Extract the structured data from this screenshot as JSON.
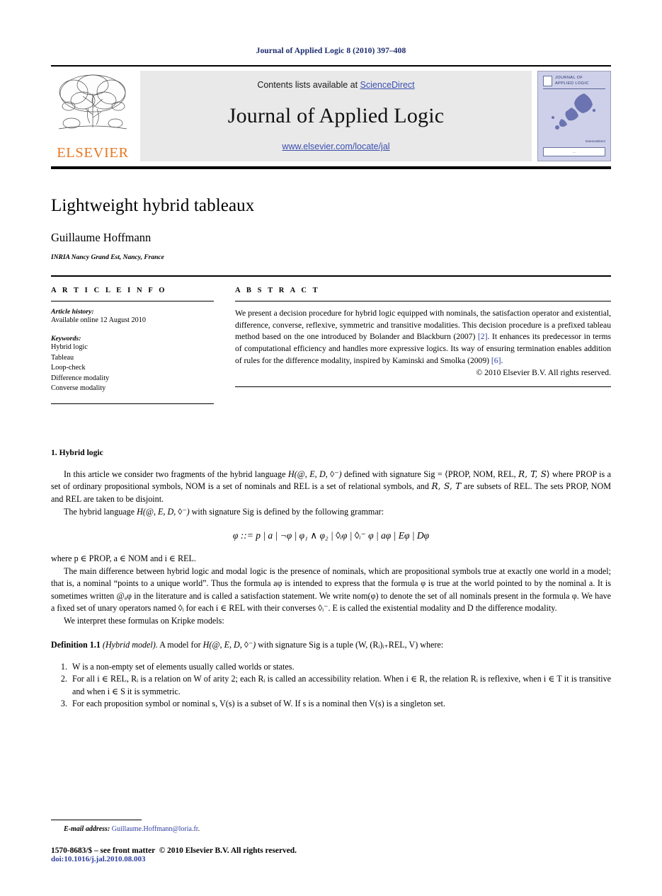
{
  "masthead": {
    "citation": "Journal of Applied Logic 8 (2010) 397–408"
  },
  "banner": {
    "contents_prefix": "Contents lists available at ",
    "sciencedirect": "ScienceDirect",
    "journal_name": "Journal of Applied Logic",
    "journal_url": "www.elsevier.com/locate/jal",
    "publisher": "ELSEVIER",
    "cover": {
      "title": "JOURNAL OF\nAPPLIED LOGIC",
      "line1": "JOURNAL OF",
      "line2": "APPLIED LOGIC",
      "sd_label": "ScienceDirect",
      "box_label": "...."
    },
    "band_color": "#e9e9e9",
    "link_color": "#3b4fb0",
    "elsevier_orange": "#E87722"
  },
  "article": {
    "title": "Lightweight hybrid tableaux",
    "author": "Guillaume Hoffmann",
    "affiliation": "INRIA Nancy Grand Est, Nancy, France"
  },
  "info": {
    "heading": "A R T I C L E   I N F O",
    "history_label": "Article history:",
    "history_value": "Available online 12 August 2010",
    "keywords_label": "Keywords:",
    "keywords": [
      "Hybrid logic",
      "Tableau",
      "Loop-check",
      "Difference modality",
      "Converse modality"
    ]
  },
  "abstract": {
    "heading": "A B S T R A C T",
    "part1": "We present a decision procedure for hybrid logic equipped with nominals, the satisfaction operator and existential, difference, converse, reflexive, symmetric and transitive modalities. This decision procedure is a prefixed tableau method based on the one introduced by Bolander and Blackburn (2007) ",
    "cite1": "[2]",
    "part2": ". It enhances its predecessor in terms of computational efficiency and handles more expressive logics. Its way of ensuring termination enables addition of rules for the difference modality, inspired by Kaminski and Smolka (2009) ",
    "cite2": "[6]",
    "part3": ".",
    "copyright": "© 2010 Elsevier B.V. All rights reserved.",
    "citation_color": "#2f3fa0"
  },
  "section1": {
    "heading": "1.  Hybrid logic",
    "para1_a": "In this article we consider two fragments of the hybrid language ",
    "para1_lang": "H(@, E, D, ◊⁻)",
    "para1_b": " defined with signature Sig = ⟨PROP, NOM, REL, ",
    "para1_cal1": "R, T, S",
    "para1_c": "⟩ where PROP is a set of ordinary propositional symbols, NOM is a set of nominals and REL is a set of relational symbols, and ",
    "para1_cal2": "R, S, T",
    "para1_d": " are subsets of REL. The sets PROP, NOM and REL are taken to be disjoint.",
    "para2_a": "The hybrid language ",
    "para2_lang": "H(@, E, D, ◊⁻)",
    "para2_b": " with signature Sig is defined by the following grammar:",
    "grammar": "φ ::= p | a | ¬φ | φ₁ ∧ φ₂ | ◊ᵢφ | ◊ᵢ⁻ φ | aφ | Eφ | Dφ",
    "where_line": "where p ∈ PROP, a ∈ NOM and i ∈ REL.",
    "para3": "The main difference between hybrid logic and modal logic is the presence of nominals, which are propositional symbols true at exactly one world in a model; that is, a nominal “points to a unique world”. Thus the formula aφ is intended to express that the formula φ is true at the world pointed to by the nominal a. It is sometimes written @ₐφ in the literature and is called a satisfaction statement. We write nom(φ) to denote the set of all nominals present in the formula φ. We have a fixed set of unary operators named ◊ᵢ for each i ∈ REL with their converses ◊ᵢ⁻. E is called the existential modality and D the difference modality.",
    "para4": "We interpret these formulas on Kripke models:"
  },
  "definition": {
    "label": "Definition 1.1",
    "title": "(Hybrid model).",
    "text_a": " A model for ",
    "lang": "H(@, E, D, ◊⁻)",
    "text_b": " with signature Sig is a tuple (W, (Rᵢ)ᵢ₊REL, V) where:",
    "items": [
      "W is a non-empty set of elements usually called worlds or states.",
      "For all i ∈ REL, Rᵢ is a relation on W of arity 2; each Rᵢ is called an accessibility relation. When i ∈ R, the relation Rᵢ is reflexive, when i ∈ T it is transitive and when i ∈ S it is symmetric.",
      "For each proposition symbol or nominal s, V(s) is a subset of W. If s is a nominal then V(s) is a singleton set."
    ]
  },
  "footnote": {
    "email_label": "E-mail address:",
    "email": "Guillaume.Hoffmann@loria.fr",
    "email_suffix": ".",
    "issn": "1570-8683/$ – see front matter",
    "copyright": "© 2010 Elsevier B.V. All rights reserved.",
    "doi": "doi:10.1016/j.jal.2010.08.003",
    "link_color": "#2f3fa0"
  }
}
